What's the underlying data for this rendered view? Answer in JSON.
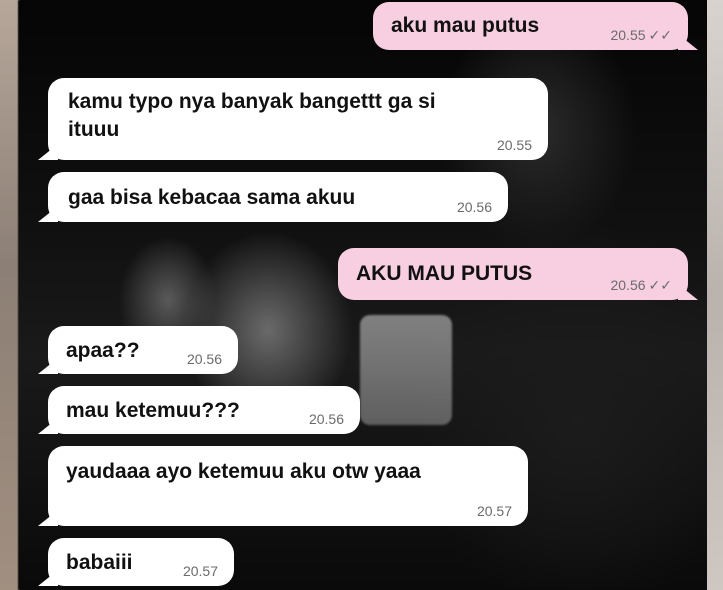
{
  "messages": [
    {
      "dir": "out",
      "text": "aku mau putus",
      "time": "20.55",
      "ticks": "✓✓"
    },
    {
      "dir": "in",
      "text": "kamu typo nya banyak bangettt ga si",
      "text2": "ituuu",
      "time": "20.55"
    },
    {
      "dir": "in",
      "text": "gaa bisa kebacaa sama akuu",
      "time": "20.56"
    },
    {
      "dir": "out",
      "text": "AKU MAU PUTUS",
      "time": "20.56",
      "ticks": "✓✓"
    },
    {
      "dir": "in",
      "text": "apaa??",
      "time": "20.56"
    },
    {
      "dir": "in",
      "text": "mau ketemuu???",
      "time": "20.56"
    },
    {
      "dir": "in",
      "text": "yaudaaa ayo ketemuu aku otw yaaa",
      "time": "20.57"
    },
    {
      "dir": "in",
      "text": "babaiii",
      "time": "20.57"
    }
  ],
  "colors": {
    "incoming_bubble": "#ffffff",
    "outgoing_bubble": "#f7cfe0",
    "timestamp": "#6b6b6b"
  },
  "icons": {
    "read_receipt": "double-check-icon"
  }
}
